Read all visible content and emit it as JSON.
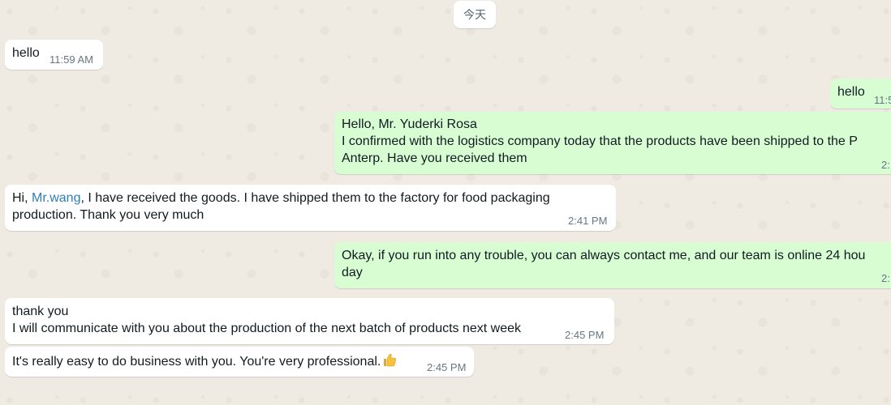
{
  "date_separator": "今天",
  "messages": [
    {
      "lines": [
        "hello"
      ],
      "time": "11:59 AM"
    },
    {
      "lines": [
        "hello"
      ],
      "time": "11:5"
    },
    {
      "lines": [
        "Hello, Mr. Yuderki Rosa",
        "I confirmed with the logistics company today that the products have been shipped to the P",
        "Anterp. Have you received them"
      ],
      "time": "2:"
    },
    {
      "greeting": "Hi, ",
      "mention": "Mr.wang",
      "rest": ", I have received the goods. I have shipped them to the factory for food packaging",
      "line2": "production. Thank you very much",
      "time": "2:41 PM"
    },
    {
      "lines": [
        "Okay, if you run into any trouble, you can always contact me, and our team is online 24 hou",
        "day"
      ],
      "time": "2:"
    },
    {
      "lines": [
        "thank you",
        "I will communicate with you about the production of the next batch of products next week"
      ],
      "time": "2:45 PM"
    },
    {
      "lines": [
        "It's really easy to do business with you.  You're very professional."
      ],
      "emoji": "thumbs-up-icon",
      "time": "2:45 PM"
    }
  ]
}
